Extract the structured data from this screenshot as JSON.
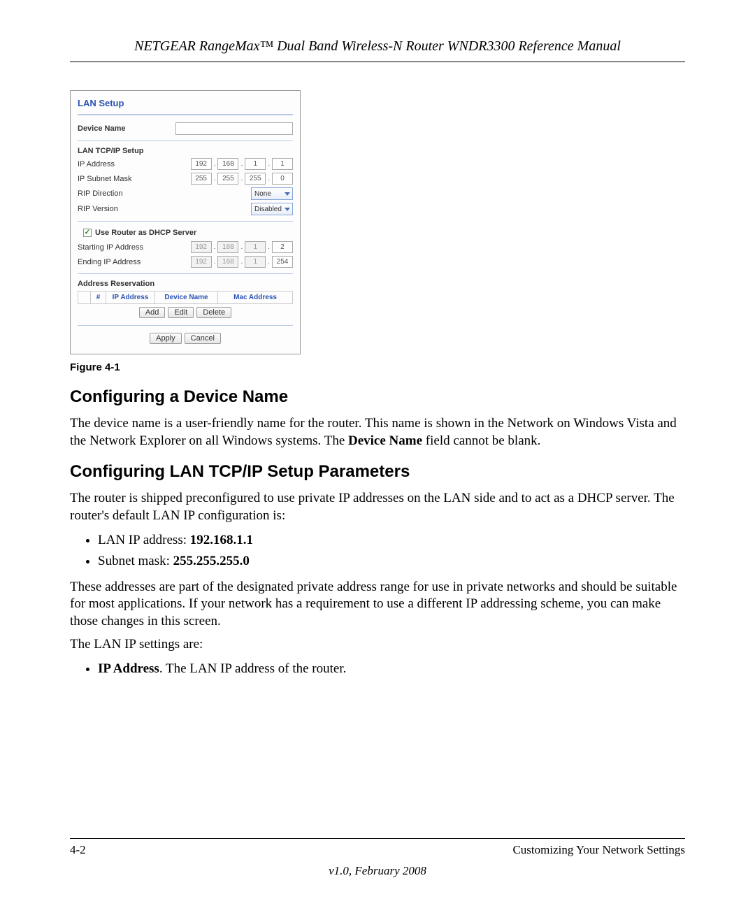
{
  "header": {
    "title": "NETGEAR RangeMax™ Dual Band Wireless-N Router WNDR3300 Reference Manual"
  },
  "panel": {
    "title": "LAN Setup",
    "device_name_label": "Device Name",
    "section_tcpip": "LAN TCP/IP Setup",
    "ip_address_label": "IP Address",
    "ip_address": [
      "192",
      "168",
      "1",
      "1"
    ],
    "subnet_label": "IP Subnet Mask",
    "subnet": [
      "255",
      "255",
      "255",
      "0"
    ],
    "rip_dir_label": "RIP Direction",
    "rip_dir_value": "None",
    "rip_ver_label": "RIP Version",
    "rip_ver_value": "Disabled",
    "dhcp_checkbox_label": "Use Router as DHCP Server",
    "dhcp_checked": "✓",
    "start_ip_label": "Starting IP Address",
    "start_ip": [
      "192",
      "168",
      "1",
      "2"
    ],
    "end_ip_label": "Ending IP Address",
    "end_ip": [
      "192",
      "168",
      "1",
      "254"
    ],
    "addr_res_label": "Address Reservation",
    "table": {
      "c1": "#",
      "c2": "IP Address",
      "c3": "Device Name",
      "c4": "Mac Address"
    },
    "btn_add": "Add",
    "btn_edit": "Edit",
    "btn_delete": "Delete",
    "btn_apply": "Apply",
    "btn_cancel": "Cancel"
  },
  "figure_caption": "Figure 4-1",
  "section1": {
    "heading": "Configuring a Device Name",
    "para_a": "The device name is a user-friendly name for the router. This name is shown in the Network on Windows Vista and the Network Explorer on all Windows systems. The ",
    "para_b": "Device Name",
    "para_c": " field cannot be blank."
  },
  "section2": {
    "heading": "Configuring LAN TCP/IP Setup Parameters",
    "para1": "The router is shipped preconfigured to use private IP addresses on the LAN side and to act as a DHCP server. The router's default LAN IP configuration is:",
    "bullet1_a": "LAN IP address: ",
    "bullet1_b": "192.168.1.1",
    "bullet2_a": "Subnet mask: ",
    "bullet2_b": "255.255.255.0",
    "para2": "These addresses are part of the designated private address range for use in private networks and should be suitable for most applications. If your network has a requirement to use a different IP addressing scheme, you can make those changes in this screen.",
    "para3": "The LAN IP settings are:",
    "bullet3_a": "IP Address",
    "bullet3_b": ". The LAN IP address of the router."
  },
  "footer": {
    "page": "4-2",
    "chapter": "Customizing Your Network Settings",
    "version": "v1.0, February 2008"
  }
}
